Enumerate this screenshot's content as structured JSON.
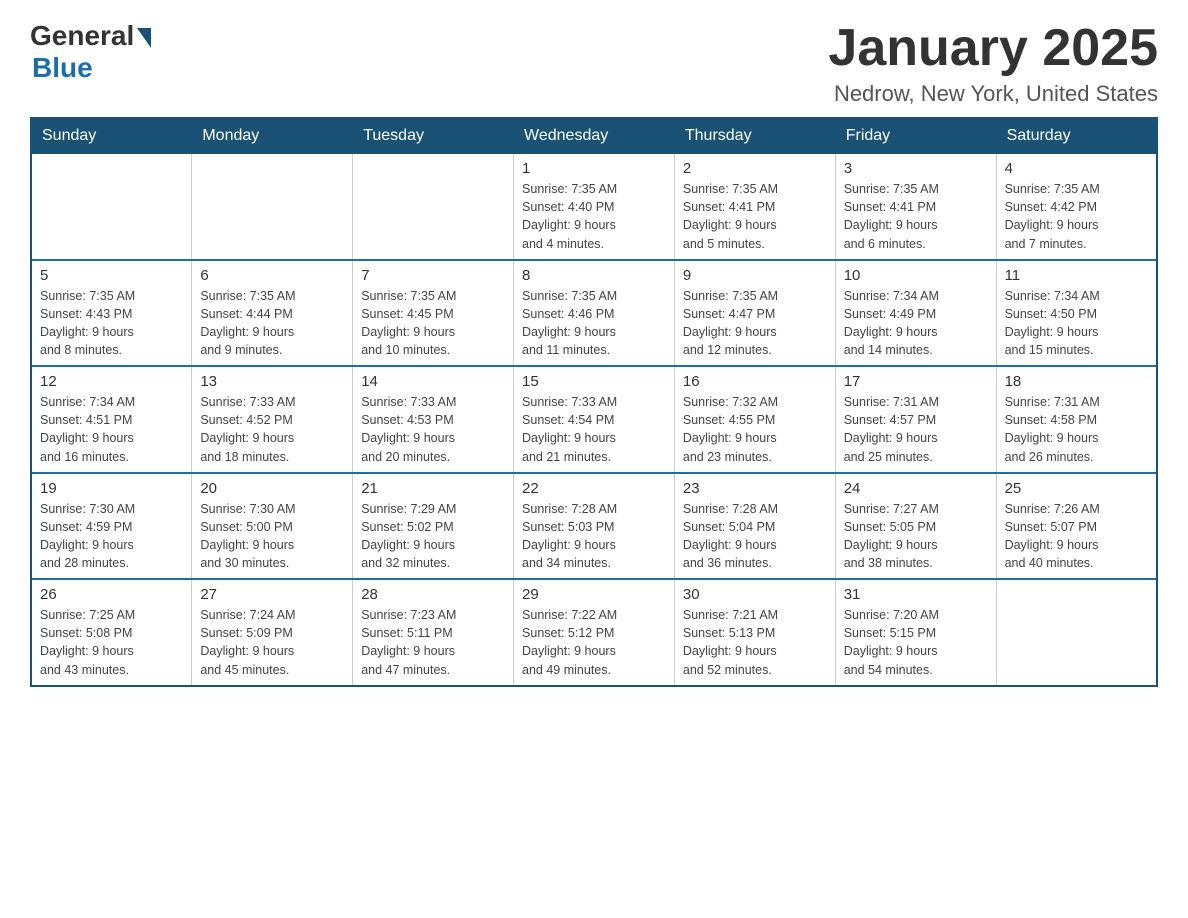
{
  "logo": {
    "general": "General",
    "blue": "Blue"
  },
  "title": "January 2025",
  "subtitle": "Nedrow, New York, United States",
  "days_header": [
    "Sunday",
    "Monday",
    "Tuesday",
    "Wednesday",
    "Thursday",
    "Friday",
    "Saturday"
  ],
  "weeks": [
    [
      {
        "day": "",
        "info": ""
      },
      {
        "day": "",
        "info": ""
      },
      {
        "day": "",
        "info": ""
      },
      {
        "day": "1",
        "info": "Sunrise: 7:35 AM\nSunset: 4:40 PM\nDaylight: 9 hours\nand 4 minutes."
      },
      {
        "day": "2",
        "info": "Sunrise: 7:35 AM\nSunset: 4:41 PM\nDaylight: 9 hours\nand 5 minutes."
      },
      {
        "day": "3",
        "info": "Sunrise: 7:35 AM\nSunset: 4:41 PM\nDaylight: 9 hours\nand 6 minutes."
      },
      {
        "day": "4",
        "info": "Sunrise: 7:35 AM\nSunset: 4:42 PM\nDaylight: 9 hours\nand 7 minutes."
      }
    ],
    [
      {
        "day": "5",
        "info": "Sunrise: 7:35 AM\nSunset: 4:43 PM\nDaylight: 9 hours\nand 8 minutes."
      },
      {
        "day": "6",
        "info": "Sunrise: 7:35 AM\nSunset: 4:44 PM\nDaylight: 9 hours\nand 9 minutes."
      },
      {
        "day": "7",
        "info": "Sunrise: 7:35 AM\nSunset: 4:45 PM\nDaylight: 9 hours\nand 10 minutes."
      },
      {
        "day": "8",
        "info": "Sunrise: 7:35 AM\nSunset: 4:46 PM\nDaylight: 9 hours\nand 11 minutes."
      },
      {
        "day": "9",
        "info": "Sunrise: 7:35 AM\nSunset: 4:47 PM\nDaylight: 9 hours\nand 12 minutes."
      },
      {
        "day": "10",
        "info": "Sunrise: 7:34 AM\nSunset: 4:49 PM\nDaylight: 9 hours\nand 14 minutes."
      },
      {
        "day": "11",
        "info": "Sunrise: 7:34 AM\nSunset: 4:50 PM\nDaylight: 9 hours\nand 15 minutes."
      }
    ],
    [
      {
        "day": "12",
        "info": "Sunrise: 7:34 AM\nSunset: 4:51 PM\nDaylight: 9 hours\nand 16 minutes."
      },
      {
        "day": "13",
        "info": "Sunrise: 7:33 AM\nSunset: 4:52 PM\nDaylight: 9 hours\nand 18 minutes."
      },
      {
        "day": "14",
        "info": "Sunrise: 7:33 AM\nSunset: 4:53 PM\nDaylight: 9 hours\nand 20 minutes."
      },
      {
        "day": "15",
        "info": "Sunrise: 7:33 AM\nSunset: 4:54 PM\nDaylight: 9 hours\nand 21 minutes."
      },
      {
        "day": "16",
        "info": "Sunrise: 7:32 AM\nSunset: 4:55 PM\nDaylight: 9 hours\nand 23 minutes."
      },
      {
        "day": "17",
        "info": "Sunrise: 7:31 AM\nSunset: 4:57 PM\nDaylight: 9 hours\nand 25 minutes."
      },
      {
        "day": "18",
        "info": "Sunrise: 7:31 AM\nSunset: 4:58 PM\nDaylight: 9 hours\nand 26 minutes."
      }
    ],
    [
      {
        "day": "19",
        "info": "Sunrise: 7:30 AM\nSunset: 4:59 PM\nDaylight: 9 hours\nand 28 minutes."
      },
      {
        "day": "20",
        "info": "Sunrise: 7:30 AM\nSunset: 5:00 PM\nDaylight: 9 hours\nand 30 minutes."
      },
      {
        "day": "21",
        "info": "Sunrise: 7:29 AM\nSunset: 5:02 PM\nDaylight: 9 hours\nand 32 minutes."
      },
      {
        "day": "22",
        "info": "Sunrise: 7:28 AM\nSunset: 5:03 PM\nDaylight: 9 hours\nand 34 minutes."
      },
      {
        "day": "23",
        "info": "Sunrise: 7:28 AM\nSunset: 5:04 PM\nDaylight: 9 hours\nand 36 minutes."
      },
      {
        "day": "24",
        "info": "Sunrise: 7:27 AM\nSunset: 5:05 PM\nDaylight: 9 hours\nand 38 minutes."
      },
      {
        "day": "25",
        "info": "Sunrise: 7:26 AM\nSunset: 5:07 PM\nDaylight: 9 hours\nand 40 minutes."
      }
    ],
    [
      {
        "day": "26",
        "info": "Sunrise: 7:25 AM\nSunset: 5:08 PM\nDaylight: 9 hours\nand 43 minutes."
      },
      {
        "day": "27",
        "info": "Sunrise: 7:24 AM\nSunset: 5:09 PM\nDaylight: 9 hours\nand 45 minutes."
      },
      {
        "day": "28",
        "info": "Sunrise: 7:23 AM\nSunset: 5:11 PM\nDaylight: 9 hours\nand 47 minutes."
      },
      {
        "day": "29",
        "info": "Sunrise: 7:22 AM\nSunset: 5:12 PM\nDaylight: 9 hours\nand 49 minutes."
      },
      {
        "day": "30",
        "info": "Sunrise: 7:21 AM\nSunset: 5:13 PM\nDaylight: 9 hours\nand 52 minutes."
      },
      {
        "day": "31",
        "info": "Sunrise: 7:20 AM\nSunset: 5:15 PM\nDaylight: 9 hours\nand 54 minutes."
      },
      {
        "day": "",
        "info": ""
      }
    ]
  ]
}
